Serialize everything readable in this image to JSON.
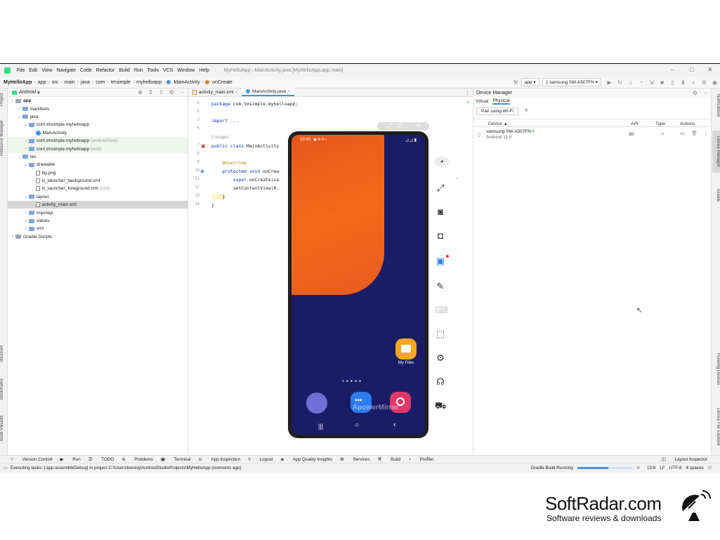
{
  "menubar": {
    "items": [
      "File",
      "Edit",
      "View",
      "Navigate",
      "Code",
      "Refactor",
      "Build",
      "Run",
      "Tools",
      "VCS",
      "Window",
      "Help"
    ],
    "window_title": "MyHelloApp - MainActivity.java [MyHelloApp.app.main]"
  },
  "navbar": {
    "crumbs": [
      "MyHelloApp",
      "app",
      "src",
      "main",
      "java",
      "com",
      "tmsimple",
      "myhelloapp",
      "MainActivity",
      "onCreate"
    ],
    "run_config": "app",
    "device": "samsung SM-A507FN"
  },
  "left_tools": [
    "Project",
    "Resource Manager",
    "Structure",
    "Bookmarks",
    "Build Variants"
  ],
  "project": {
    "view_mode": "Android",
    "tree": [
      {
        "label": "app",
        "level": 0,
        "chev": "v",
        "kind": "folder",
        "bold": true
      },
      {
        "label": "manifests",
        "level": 1,
        "chev": ">",
        "kind": "folder"
      },
      {
        "label": "java",
        "level": 1,
        "chev": "v",
        "kind": "folder"
      },
      {
        "label": "com.tmsimple.myhelloapp",
        "level": 2,
        "chev": "v",
        "kind": "folder"
      },
      {
        "label": "MainActivity",
        "level": 3,
        "chev": "",
        "kind": "class"
      },
      {
        "label": "com.tmsimple.myhelloapp",
        "suffix": "(androidTest)",
        "level": 2,
        "chev": ">",
        "kind": "folder",
        "hl": true
      },
      {
        "label": "com.tmsimple.myhelloapp",
        "suffix": "(test)",
        "level": 2,
        "chev": ">",
        "kind": "folder",
        "hl": true
      },
      {
        "label": "res",
        "level": 1,
        "chev": "v",
        "kind": "folder"
      },
      {
        "label": "drawable",
        "level": 2,
        "chev": "v",
        "kind": "folder"
      },
      {
        "label": "bg.png",
        "level": 3,
        "chev": "",
        "kind": "file"
      },
      {
        "label": "ic_launcher_background.xml",
        "level": 3,
        "chev": "",
        "kind": "file"
      },
      {
        "label": "ic_launcher_foreground.xml",
        "suffix": "(v24)",
        "level": 3,
        "chev": "",
        "kind": "file"
      },
      {
        "label": "layout",
        "level": 2,
        "chev": "v",
        "kind": "folder"
      },
      {
        "label": "activity_main.xml",
        "level": 3,
        "chev": "",
        "kind": "file",
        "sel": true
      },
      {
        "label": "mipmap",
        "level": 2,
        "chev": ">",
        "kind": "folder"
      },
      {
        "label": "values",
        "level": 2,
        "chev": ">",
        "kind": "folder"
      },
      {
        "label": "xml",
        "level": 2,
        "chev": ">",
        "kind": "folder"
      },
      {
        "label": "Gradle Scripts",
        "level": 0,
        "chev": ">",
        "kind": "folder"
      }
    ]
  },
  "editor": {
    "tabs": [
      {
        "label": "activity_main.xml",
        "active": false
      },
      {
        "label": "MainActivity.java",
        "active": true
      }
    ],
    "line_numbers": [
      "1",
      "2",
      "3",
      "6",
      "7",
      "8",
      "9",
      "10",
      "11",
      "12",
      "13",
      "14"
    ],
    "usages": "2 usages",
    "lines": [
      {
        "n": "1",
        "segs": [
          [
            "kw",
            "package "
          ],
          [
            "",
            "com.tmsimple.myhelloapp;"
          ]
        ]
      },
      {
        "n": "3",
        "segs": [
          [
            "kw",
            "import "
          ],
          [
            "",
            "..."
          ]
        ]
      },
      {
        "n": "7",
        "segs": [
          [
            "kw",
            "public class "
          ],
          [
            "",
            "MainActivity"
          ]
        ]
      },
      {
        "n": "9",
        "segs": [
          [
            "an",
            "    @Override"
          ]
        ]
      },
      {
        "n": "10",
        "segs": [
          [
            "kw",
            "    protected void "
          ],
          [
            "",
            "onCrea"
          ]
        ]
      },
      {
        "n": "11",
        "segs": [
          [
            "",
            "        "
          ],
          [
            "kw",
            "super"
          ],
          [
            "",
            ".onCreate(sa"
          ]
        ]
      },
      {
        "n": "12",
        "segs": [
          [
            "",
            "        setContentView(R."
          ]
        ]
      },
      {
        "n": "13",
        "segs": [
          [
            "",
            "    }"
          ]
        ]
      },
      {
        "n": "14",
        "segs": [
          [
            "",
            "}"
          ]
        ]
      }
    ]
  },
  "device_manager": {
    "title": "Device Manager",
    "tabs": [
      "Virtual",
      "Physical"
    ],
    "pair_button": "Pair using Wi-Fi",
    "help": "?",
    "columns": [
      "Device",
      "API",
      "Type",
      "Actions"
    ],
    "device_name": "samsung SM-A507FN",
    "device_os": "Android 11.0",
    "api": "30"
  },
  "right_tools": [
    "Notifications",
    "Device Manager",
    "Gradle",
    "Running Devices",
    "Device File Explorer"
  ],
  "bottom_tools": [
    "Version Control",
    "Run",
    "TODO",
    "Problems",
    "Terminal",
    "App Inspection",
    "Logcat",
    "App Quality Insights",
    "Services",
    "Build",
    "Profiler"
  ],
  "layout_inspector": "Layout Inspector",
  "status": {
    "task": "Executing tasks: [:app:assembleDebug] in project C:\\Users\\bening\\AndroidStudioProjects\\MyHelloApp (moments ago)",
    "gradle": "Gradle Build Running",
    "position": "13:6",
    "line_sep": "LF",
    "encoding": "UTF-8",
    "indent": "4 spaces"
  },
  "phone": {
    "time": "10:43",
    "myfiles_label": "My Files",
    "watermark": "ApowerMirror",
    "colors": {
      "orange": "#f26a1b",
      "navy": "#1a1d66"
    }
  },
  "brand": {
    "name": "SoftRadar.com",
    "tagline": "Software reviews & downloads"
  }
}
